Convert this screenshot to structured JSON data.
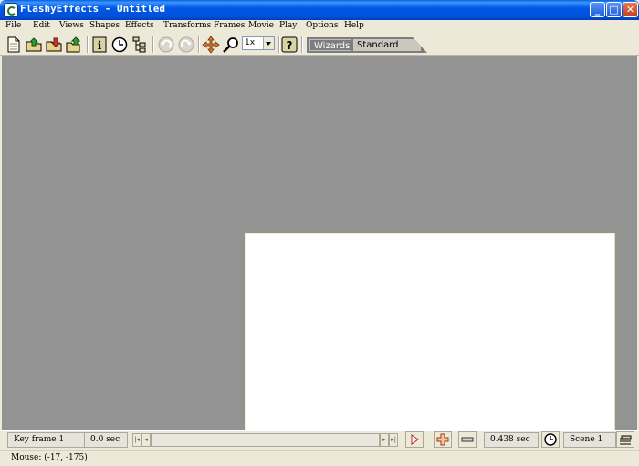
{
  "window": {
    "title": "FlashyEffects - Untitled"
  },
  "menu": [
    "File",
    "Edit",
    "Views",
    "Shapes",
    "Effects",
    "Transforms",
    "Frames",
    "Movie",
    "Play",
    "Options",
    "Help"
  ],
  "toolbar": {
    "zoom_value": "1x",
    "mode_tabs": {
      "wizards": "Wizards",
      "standard": "Standard",
      "active": "Standard"
    }
  },
  "timeline": {
    "frame_label": "Key frame 1",
    "time": "0.0 sec",
    "duration": "0.438 sec",
    "scene": "Scene 1"
  },
  "status": {
    "mouse": "Mouse: (-17, -175)"
  },
  "colors": {
    "titlebar": "#0054e3",
    "workspace": "#939393",
    "stage": "#ffffff",
    "chrome": "#ece9d8"
  }
}
